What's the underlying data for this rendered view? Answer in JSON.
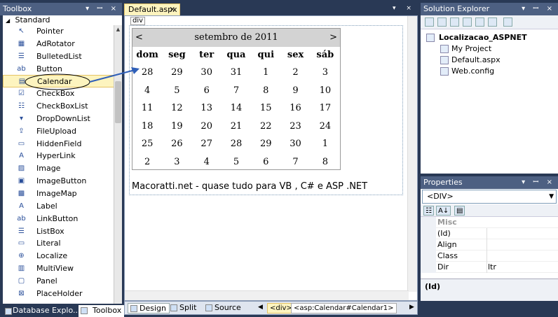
{
  "toolbox": {
    "title": "Toolbox",
    "title_buttons": "▾ ꟷ ×",
    "group": "Standard",
    "items": [
      {
        "label": "Pointer",
        "icon": "pointer-icon",
        "glyph": "↖"
      },
      {
        "label": "AdRotator",
        "icon": "adrotator-icon",
        "glyph": "▦"
      },
      {
        "label": "BulletedList",
        "icon": "bulletedlist-icon",
        "glyph": "☰"
      },
      {
        "label": "Button",
        "icon": "button-icon",
        "glyph": "ab"
      },
      {
        "label": "Calendar",
        "icon": "calendar-icon",
        "glyph": "▤"
      },
      {
        "label": "CheckBox",
        "icon": "checkbox-icon",
        "glyph": "☑"
      },
      {
        "label": "CheckBoxList",
        "icon": "checkboxlist-icon",
        "glyph": "☷"
      },
      {
        "label": "DropDownList",
        "icon": "dropdownlist-icon",
        "glyph": "▾"
      },
      {
        "label": "FileUpload",
        "icon": "fileupload-icon",
        "glyph": "⇪"
      },
      {
        "label": "HiddenField",
        "icon": "hiddenfield-icon",
        "glyph": "▭"
      },
      {
        "label": "HyperLink",
        "icon": "hyperlink-icon",
        "glyph": "A"
      },
      {
        "label": "Image",
        "icon": "image-icon",
        "glyph": "▨"
      },
      {
        "label": "ImageButton",
        "icon": "imagebutton-icon",
        "glyph": "▣"
      },
      {
        "label": "ImageMap",
        "icon": "imagemap-icon",
        "glyph": "▩"
      },
      {
        "label": "Label",
        "icon": "label-icon",
        "glyph": "A"
      },
      {
        "label": "LinkButton",
        "icon": "linkbutton-icon",
        "glyph": "ab"
      },
      {
        "label": "ListBox",
        "icon": "listbox-icon",
        "glyph": "☰"
      },
      {
        "label": "Literal",
        "icon": "literal-icon",
        "glyph": "▭"
      },
      {
        "label": "Localize",
        "icon": "localize-icon",
        "glyph": "⊕"
      },
      {
        "label": "MultiView",
        "icon": "multiview-icon",
        "glyph": "▥"
      },
      {
        "label": "Panel",
        "icon": "panel-icon",
        "glyph": "▢"
      },
      {
        "label": "PlaceHolder",
        "icon": "placeholder-icon",
        "glyph": "⊠"
      }
    ],
    "selected_index": 4,
    "bottom_tabs": [
      "Database Explo...",
      "Toolbox"
    ]
  },
  "editor": {
    "tab_label": "Default.aspx",
    "tab_close": "×",
    "div_tag": "div",
    "calendar": {
      "month_title": "setembro de 2011",
      "prev": "<",
      "next": ">",
      "days_of_week": [
        "dom",
        "seg",
        "ter",
        "qua",
        "qui",
        "sex",
        "sáb"
      ],
      "weeks": [
        [
          "28",
          "29",
          "30",
          "31",
          "1",
          "2",
          "3"
        ],
        [
          "4",
          "5",
          "6",
          "7",
          "8",
          "9",
          "10"
        ],
        [
          "11",
          "12",
          "13",
          "14",
          "15",
          "16",
          "17"
        ],
        [
          "18",
          "19",
          "20",
          "21",
          "22",
          "23",
          "24"
        ],
        [
          "25",
          "26",
          "27",
          "28",
          "29",
          "30",
          "1"
        ],
        [
          "2",
          "3",
          "4",
          "5",
          "6",
          "7",
          "8"
        ]
      ]
    },
    "footer_text": "Macoratti.net - quase tudo para VB , C# e ASP .NET",
    "view_buttons": [
      "Design",
      "Split",
      "Source"
    ],
    "active_view": "Design",
    "breadcrumb": [
      "<div>",
      "<asp:Calendar#Calendar1>"
    ]
  },
  "solution_explorer": {
    "title": "Solution Explorer",
    "title_buttons": "▾ ꟷ ×",
    "project": "Localizacao_ASPNET",
    "children": [
      "My Project",
      "Default.aspx",
      "Web.config"
    ]
  },
  "properties": {
    "title": "Properties",
    "title_buttons": "▾ ꟷ ×",
    "selected_object": "<DIV>",
    "category": "Misc",
    "rows": [
      {
        "name": "(Id)",
        "value": ""
      },
      {
        "name": "Align",
        "value": ""
      },
      {
        "name": "Class",
        "value": ""
      },
      {
        "name": "Dir",
        "value": "ltr"
      }
    ],
    "description_title": "(Id)"
  }
}
